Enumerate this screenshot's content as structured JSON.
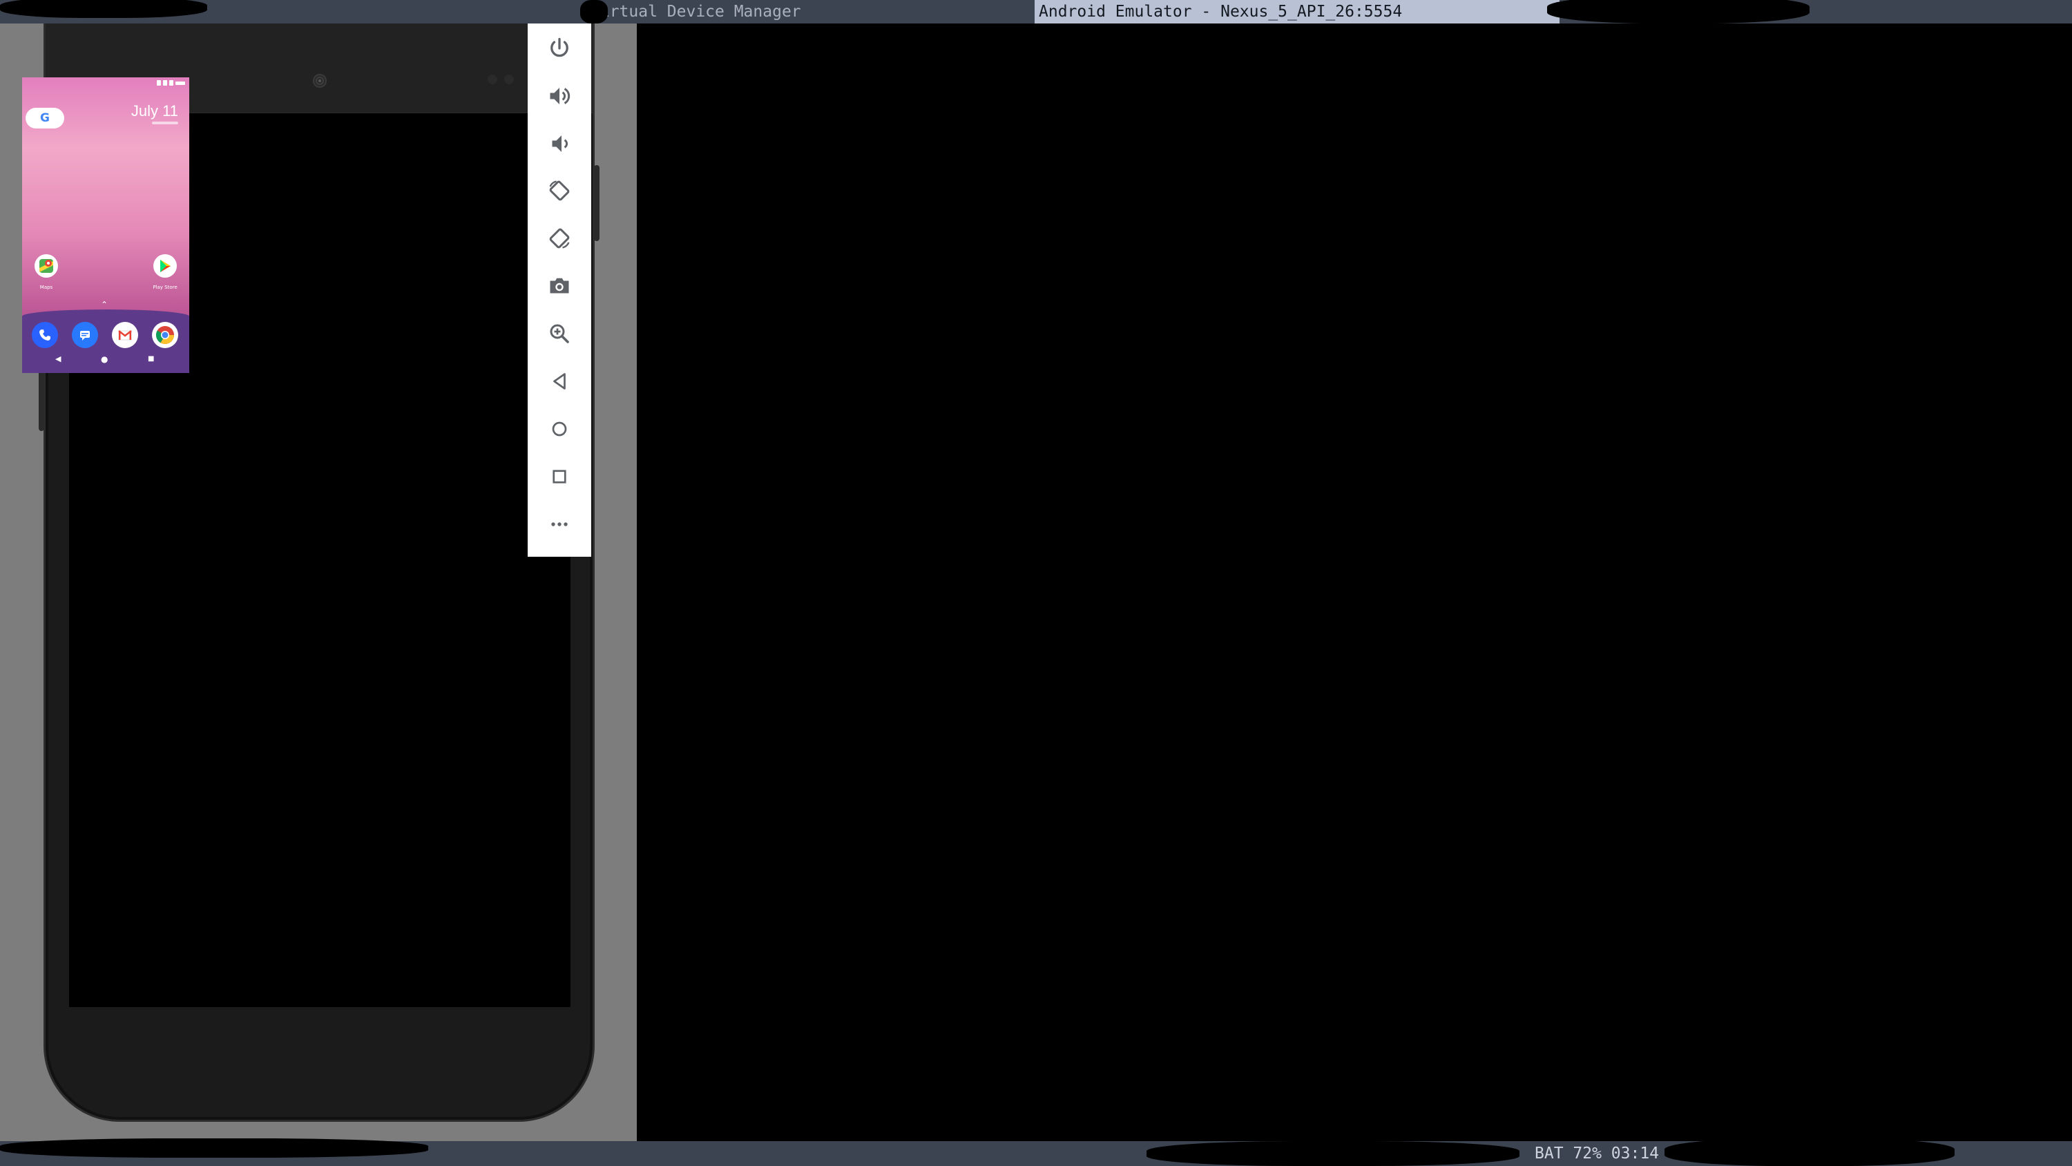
{
  "window_manager": {
    "tabs": [
      {
        "label": "Virtual Device Manager",
        "active": false
      },
      {
        "label": "Android Emulator - Nexus_5_API_26:5554",
        "active": true
      }
    ],
    "status_bar": {
      "text": "BAT 72% 03:14"
    }
  },
  "phone_screen": {
    "date": "July 11",
    "google_label": "G",
    "home_apps": [
      {
        "label": "Maps",
        "icon": "maps-icon"
      },
      {
        "label": "Play Store",
        "icon": "play-store-icon"
      }
    ],
    "dock_apps": [
      {
        "icon": "phone-icon"
      },
      {
        "icon": "messages-icon"
      },
      {
        "icon": "gmail-icon"
      },
      {
        "icon": "chrome-icon"
      }
    ],
    "nav": {
      "back": "◀",
      "home": "●",
      "recents": "■"
    }
  },
  "toolbar": {
    "buttons": [
      {
        "name": "power-button",
        "icon": "power-icon"
      },
      {
        "name": "volume-up-button",
        "icon": "volume-up-icon"
      },
      {
        "name": "volume-down-button",
        "icon": "volume-down-icon"
      },
      {
        "name": "rotate-left-button",
        "icon": "rotate-left-icon"
      },
      {
        "name": "rotate-right-button",
        "icon": "rotate-right-icon"
      },
      {
        "name": "screenshot-button",
        "icon": "camera-icon"
      },
      {
        "name": "zoom-button",
        "icon": "zoom-icon"
      },
      {
        "name": "back-button",
        "icon": "back-triangle-icon"
      },
      {
        "name": "home-button",
        "icon": "home-circle-icon"
      },
      {
        "name": "overview-button",
        "icon": "overview-square-icon"
      },
      {
        "name": "more-button",
        "icon": "more-dots-icon"
      }
    ]
  },
  "colors": {
    "bar_bg": "#3d4451",
    "active_tab_bg": "#b8c2d4",
    "toolbar_icon": "#5f6368",
    "dock_bg": "#5e3a8a"
  }
}
